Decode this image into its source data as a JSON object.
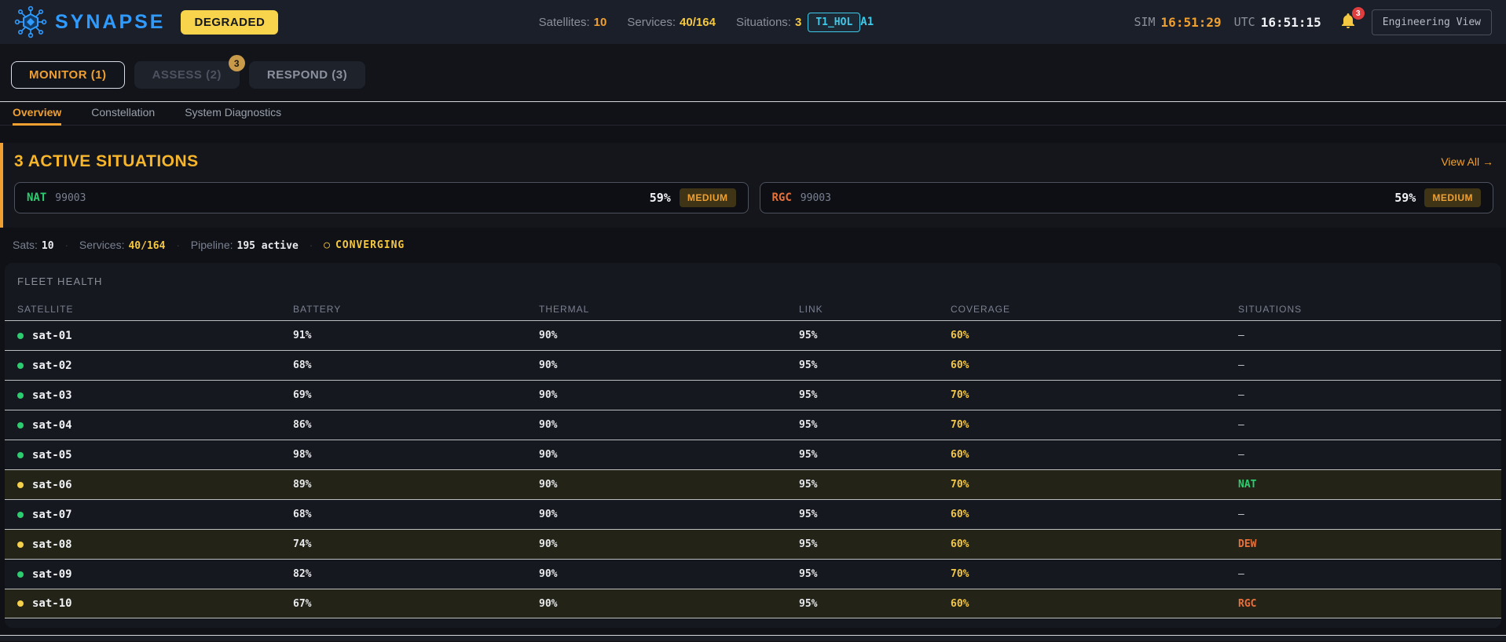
{
  "header": {
    "logo_text": "SYNAPSE",
    "status_badge": "DEGRADED",
    "stats": [
      {
        "label": "Satellites:",
        "value": "10",
        "tone": "orange"
      },
      {
        "label": "Services:",
        "value": "40/164",
        "tone": "yellow"
      },
      {
        "label": "Situations:",
        "value": "3",
        "tone": "yellow"
      }
    ],
    "mode_badge": "T1_HOL",
    "grade": "A1",
    "sim_label": "SIM",
    "sim_time": "16:51:29",
    "utc_label": "UTC",
    "utc_time": "16:51:15",
    "notification_count": "3",
    "engineering_view_label": "Engineering View"
  },
  "tabs": [
    {
      "label": "MONITOR (1)",
      "active": true,
      "dimmed": false,
      "badge": ""
    },
    {
      "label": "ASSESS (2)",
      "active": false,
      "dimmed": true,
      "badge": "3"
    },
    {
      "label": "RESPOND (3)",
      "active": false,
      "dimmed": false,
      "badge": ""
    }
  ],
  "subtabs": [
    {
      "label": "Overview",
      "active": true
    },
    {
      "label": "Constellation",
      "active": false
    },
    {
      "label": "System Diagnostics",
      "active": false
    }
  ],
  "situations": {
    "title": "3 ACTIVE SITUATIONS",
    "view_all": "View All →",
    "cards": [
      {
        "code": "NAT",
        "id": "99003",
        "percent": "59%",
        "severity": "MEDIUM",
        "code_color": "#2ecc71"
      },
      {
        "code": "RGC",
        "id": "99003",
        "percent": "59%",
        "severity": "MEDIUM",
        "code_color": "#e8713a"
      }
    ]
  },
  "statusbar": {
    "items": [
      {
        "label": "Sats:",
        "value": "10",
        "value_color": "#e8eaed"
      },
      {
        "label": "Services:",
        "value": "40/164",
        "value_color": "#f5c842"
      },
      {
        "label": "Pipeline:",
        "value": "195 active",
        "value_color": "#e8eaed"
      }
    ],
    "separator": "·",
    "state_marker": "○",
    "state": "CONVERGING"
  },
  "fleet": {
    "title": "FLEET HEALTH",
    "columns": [
      "SATELLITE",
      "BATTERY",
      "THERMAL",
      "LINK",
      "COVERAGE",
      "SITUATIONS"
    ],
    "situation_colors": {
      "NAT": "#2ecc71",
      "DEW": "#e8713a",
      "RGC": "#e8713a"
    },
    "rows": [
      {
        "name": "sat-01",
        "battery": "91%",
        "thermal": "90%",
        "link": "95%",
        "coverage": "60%",
        "situation": "–",
        "dot": "green",
        "highlight": false
      },
      {
        "name": "sat-02",
        "battery": "68%",
        "thermal": "90%",
        "link": "95%",
        "coverage": "60%",
        "situation": "–",
        "dot": "green",
        "highlight": false
      },
      {
        "name": "sat-03",
        "battery": "69%",
        "thermal": "90%",
        "link": "95%",
        "coverage": "70%",
        "situation": "–",
        "dot": "green",
        "highlight": false
      },
      {
        "name": "sat-04",
        "battery": "86%",
        "thermal": "90%",
        "link": "95%",
        "coverage": "70%",
        "situation": "–",
        "dot": "green",
        "highlight": false
      },
      {
        "name": "sat-05",
        "battery": "98%",
        "thermal": "90%",
        "link": "95%",
        "coverage": "60%",
        "situation": "–",
        "dot": "green",
        "highlight": false
      },
      {
        "name": "sat-06",
        "battery": "89%",
        "thermal": "90%",
        "link": "95%",
        "coverage": "70%",
        "situation": "NAT",
        "dot": "yellow",
        "highlight": true
      },
      {
        "name": "sat-07",
        "battery": "68%",
        "thermal": "90%",
        "link": "95%",
        "coverage": "60%",
        "situation": "–",
        "dot": "green",
        "highlight": false
      },
      {
        "name": "sat-08",
        "battery": "74%",
        "thermal": "90%",
        "link": "95%",
        "coverage": "60%",
        "situation": "DEW",
        "dot": "yellow",
        "highlight": true
      },
      {
        "name": "sat-09",
        "battery": "82%",
        "thermal": "90%",
        "link": "95%",
        "coverage": "70%",
        "situation": "–",
        "dot": "green",
        "highlight": false
      },
      {
        "name": "sat-10",
        "battery": "67%",
        "thermal": "90%",
        "link": "95%",
        "coverage": "60%",
        "situation": "RGC",
        "dot": "yellow",
        "highlight": true
      }
    ]
  }
}
